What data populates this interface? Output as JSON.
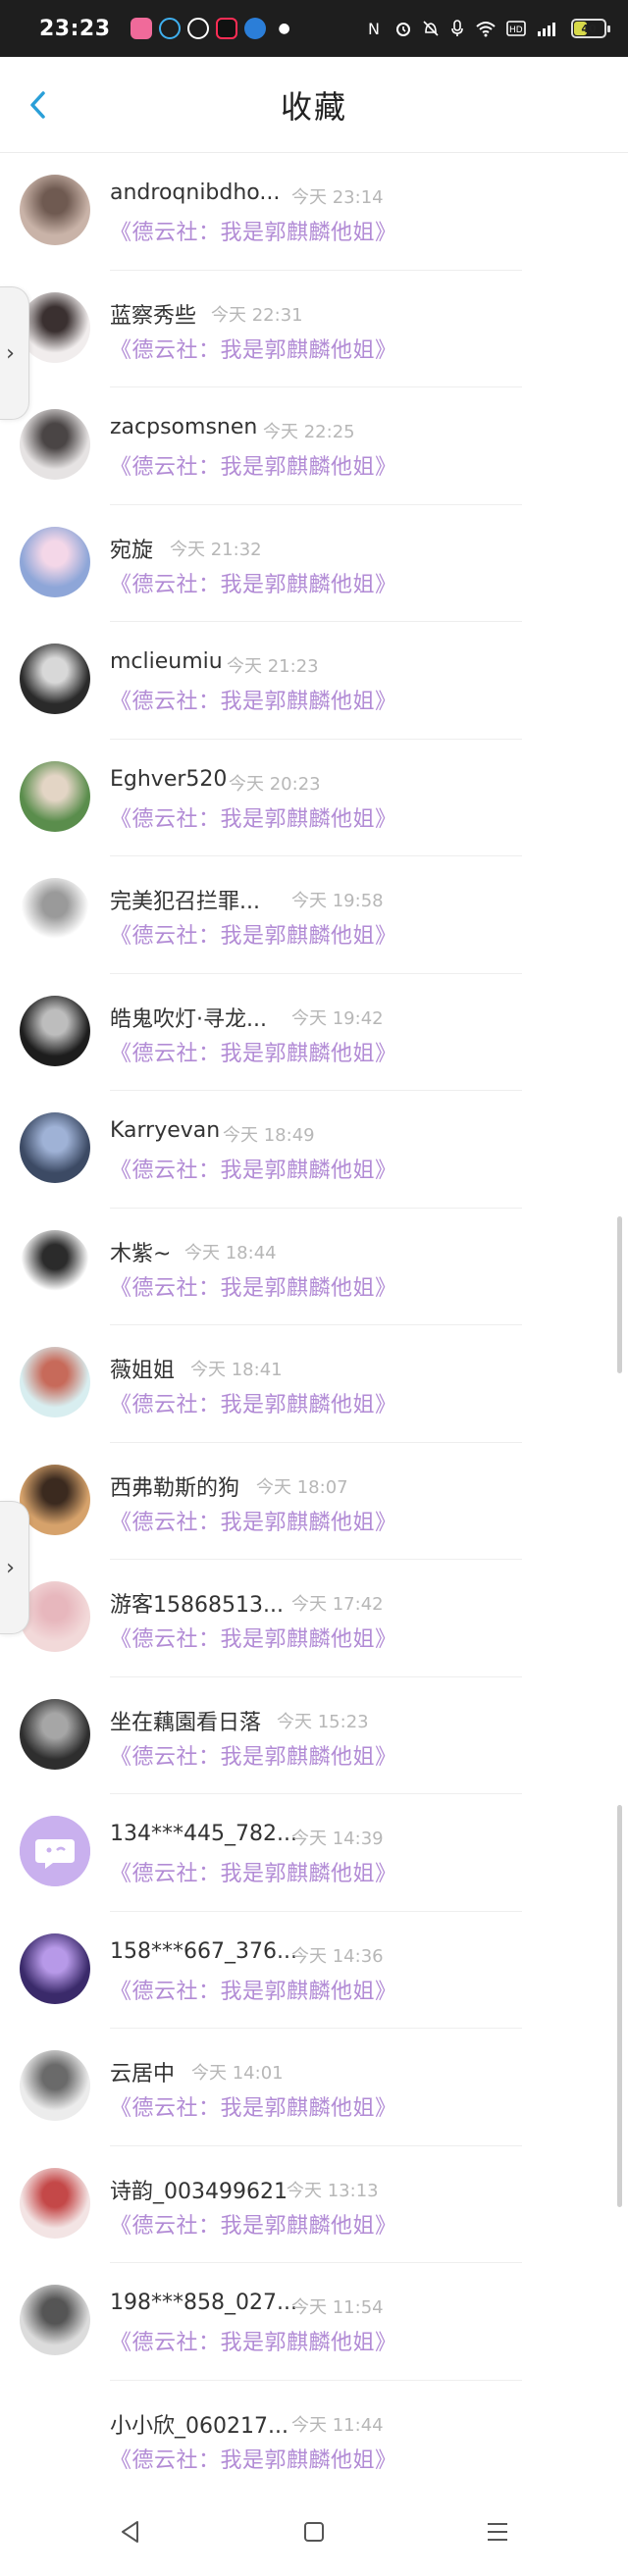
{
  "status_bar": {
    "time": "23:23",
    "battery": "40",
    "indicators": [
      "nfc-icon",
      "alarm-icon",
      "bell-off-icon",
      "mic-icon",
      "wifi-icon",
      "hd-icon",
      "signal-icon"
    ],
    "app_icons": [
      "app-pink-icon",
      "qq-icon",
      "wechat-icon",
      "tiktok-icon",
      "blue-app-icon"
    ]
  },
  "header": {
    "title": "收藏",
    "back_icon": "chevron-left-icon"
  },
  "items": [
    {
      "name": "androqnibdho...",
      "time": "今天 23:14",
      "subtitle": "《德云社：我是郭麒麟他姐》",
      "avatar_colors": [
        "#c9b3a8",
        "#6f5a51"
      ]
    },
    {
      "name": "蓝察秀些",
      "time": "今天 22:31",
      "subtitle": "《德云社：我是郭麒麟他姐》",
      "avatar_colors": [
        "#f1eded",
        "#3a3030"
      ]
    },
    {
      "name": "zacpsomsnen",
      "time": "今天 22:25",
      "subtitle": "《德云社：我是郭麒麟他姐》",
      "avatar_colors": [
        "#e6e3e3",
        "#4a4545"
      ]
    },
    {
      "name": "宛旋",
      "time": "今天 21:32",
      "subtitle": "《德云社：我是郭麒麟他姐》",
      "avatar_colors": [
        "#8ea6d8",
        "#f4d7e8"
      ]
    },
    {
      "name": "mclieumiu",
      "time": "今天 21:23",
      "subtitle": "《德云社：我是郭麒麟他姐》",
      "avatar_colors": [
        "#2a2a2a",
        "#d8d8d8"
      ]
    },
    {
      "name": "Eghver520",
      "time": "今天 20:23",
      "subtitle": "《德云社：我是郭麒麟他姐》",
      "avatar_colors": [
        "#5a8d4c",
        "#e3d5c5"
      ]
    },
    {
      "name": "完美犯召拦罪...",
      "time": "今天 19:58",
      "subtitle": "《德云社：我是郭麒麟他姐》",
      "avatar_colors": [
        "#ffffff",
        "#9a9a9a"
      ]
    },
    {
      "name": "皓鬼吹灯·寻龙...",
      "time": "今天 19:42",
      "subtitle": "《德云社：我是郭麒麟他姐》",
      "avatar_colors": [
        "#1d1d1d",
        "#bdbdbd"
      ]
    },
    {
      "name": "Karryevan",
      "time": "今天 18:49",
      "subtitle": "《德云社：我是郭麒麟他姐》",
      "avatar_colors": [
        "#3c4a64",
        "#9fb2d6"
      ]
    },
    {
      "name": "木紫~",
      "time": "今天 18:44",
      "subtitle": "《德云社：我是郭麒麟他姐》",
      "avatar_colors": [
        "#ffffff",
        "#2b2b2b"
      ]
    },
    {
      "name": "薇姐姐",
      "time": "今天 18:41",
      "subtitle": "《德云社：我是郭麒麟他姐》",
      "avatar_colors": [
        "#d8eef0",
        "#c76a5a"
      ]
    },
    {
      "name": "西弗勒斯的狗",
      "time": "今天 18:07",
      "subtitle": "《德云社：我是郭麒麟他姐》",
      "avatar_colors": [
        "#d6a26b",
        "#3b2a1f"
      ]
    },
    {
      "name": "游客15868513...",
      "time": "今天 17:42",
      "subtitle": "《德云社：我是郭麒麟他姐》",
      "avatar_colors": [
        "#f2d9d9",
        "#e7b7bd"
      ]
    },
    {
      "name": "坐在藕園看日落",
      "time": "今天 15:23",
      "subtitle": "《德云社：我是郭麒麟他姐》",
      "avatar_colors": [
        "#2e2e2e",
        "#a6a6a6"
      ]
    },
    {
      "name": "134***445_782...",
      "time": "今天 14:39",
      "subtitle": "《德云社：我是郭麒麟他姐》",
      "avatar_colors": [
        "#c9b0ee",
        "#ffffff"
      ]
    },
    {
      "name": "158***667_376...",
      "time": "今天 14:36",
      "subtitle": "《德云社：我是郭麒麟他姐》",
      "avatar_colors": [
        "#3a2a6a",
        "#b799e8"
      ]
    },
    {
      "name": "云居中",
      "time": "今天 14:01",
      "subtitle": "《德云社：我是郭麒麟他姐》",
      "avatar_colors": [
        "#ececec",
        "#6a6a6a"
      ]
    },
    {
      "name": "诗韵_003499621",
      "time": "今天 13:13",
      "subtitle": "《德云社：我是郭麒麟他姐》",
      "avatar_colors": [
        "#f3e4e4",
        "#c44848"
      ]
    },
    {
      "name": "198***858_027...",
      "time": "今天 11:54",
      "subtitle": "《德云社：我是郭麒麟他姐》",
      "avatar_colors": [
        "#dcdcdc",
        "#555555"
      ]
    },
    {
      "name": "小小欣_060217...",
      "time": "今天 11:44",
      "subtitle": "《德云社：我是郭麒麟他姐》",
      "avatar_colors": [
        "#ffffff",
        "#ffffff"
      ]
    }
  ],
  "side_tabs": [
    {
      "icon": "chevron-right-icon",
      "glyph": "›"
    },
    {
      "icon": "chevron-right-icon",
      "glyph": "›"
    }
  ],
  "bottom_nav": [
    {
      "name": "back-key",
      "icon": "triangle-back-icon"
    },
    {
      "name": "home-key",
      "icon": "square-home-icon"
    },
    {
      "name": "menu-key",
      "icon": "menu-lines-icon"
    }
  ],
  "colors": {
    "accent": "#2a9fd8",
    "subtitle": "#b28bd5",
    "time": "#b7b7b7",
    "status_bar_bg": "#1e1e1e"
  }
}
